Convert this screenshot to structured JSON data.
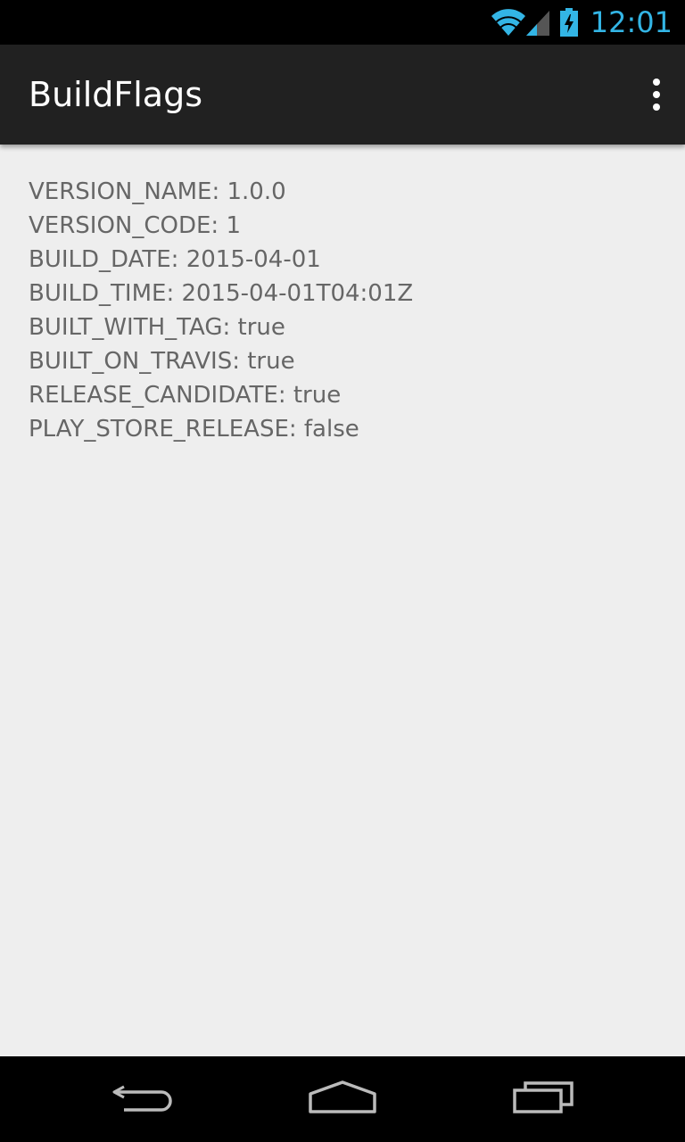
{
  "status_bar": {
    "time": "12:01",
    "icons": [
      "wifi-icon",
      "cell-signal-icon",
      "battery-charging-icon"
    ],
    "accent_color": "#33b5e5"
  },
  "action_bar": {
    "title": "BuildFlags",
    "overflow_icon": "overflow-menu-icon"
  },
  "flags": [
    {
      "text": "VERSION_NAME: 1.0.0"
    },
    {
      "text": "VERSION_CODE: 1"
    },
    {
      "text": "BUILD_DATE: 2015-04-01"
    },
    {
      "text": "BUILD_TIME: 2015-04-01T04:01Z"
    },
    {
      "text": "BUILT_WITH_TAG: true"
    },
    {
      "text": "BUILT_ON_TRAVIS: true"
    },
    {
      "text": "RELEASE_CANDIDATE: true"
    },
    {
      "text": "PLAY_STORE_RELEASE: false"
    }
  ],
  "nav_bar": {
    "buttons": [
      "back-icon",
      "home-icon",
      "recents-icon"
    ]
  }
}
